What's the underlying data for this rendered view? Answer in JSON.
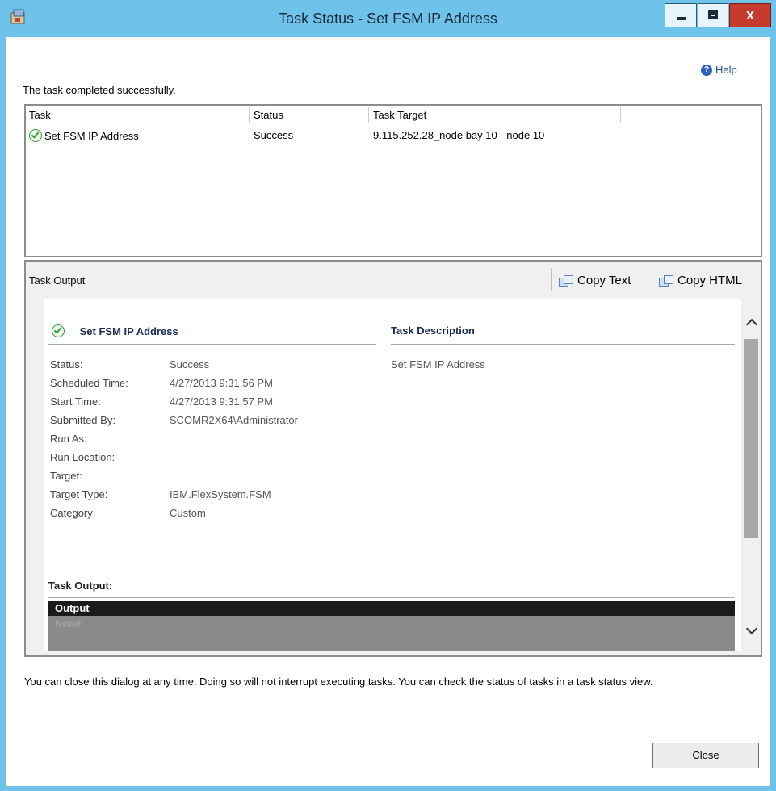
{
  "window": {
    "title": "Task Status - Set FSM IP Address",
    "help_label": "Help",
    "status_message": "The task completed successfully."
  },
  "task_table": {
    "columns": [
      "Task",
      "Status",
      "Task Target"
    ],
    "rows": [
      {
        "task": "Set FSM IP Address",
        "status": "Success",
        "target": "9.115.252.28_node bay 10 - node 10"
      }
    ]
  },
  "task_output": {
    "panel_title": "Task Output",
    "copy_text_label": "Copy Text",
    "copy_html_label": "Copy HTML",
    "task_name": "Set FSM IP Address",
    "description_heading": "Task Description",
    "description": "Set FSM IP Address",
    "fields": [
      {
        "label": "Status:",
        "value": "Success"
      },
      {
        "label": "Scheduled Time:",
        "value": "4/27/2013 9:31:56 PM"
      },
      {
        "label": "Start Time:",
        "value": "4/27/2013 9:31:57 PM"
      },
      {
        "label": "Submitted By:",
        "value": "SCOMR2X64\\Administrator"
      },
      {
        "label": "Run As:",
        "value": ""
      },
      {
        "label": "Run Location:",
        "value": ""
      },
      {
        "label": "Target:",
        "value": ""
      },
      {
        "label": "Target Type:",
        "value": "IBM.FlexSystem.FSM"
      },
      {
        "label": "Category:",
        "value": "Custom"
      }
    ],
    "output_heading": "Task Output:",
    "output_column": "Output",
    "output_value": "None"
  },
  "footer": {
    "note": "You can close this dialog at any time. Doing so will not interrupt executing tasks. You can check the status of tasks in a task status view.",
    "close_label": "Close"
  },
  "colors": {
    "titlebar": "#6fc3ea",
    "close_button": "#c73a2e",
    "accent_text": "#1a2a50"
  }
}
